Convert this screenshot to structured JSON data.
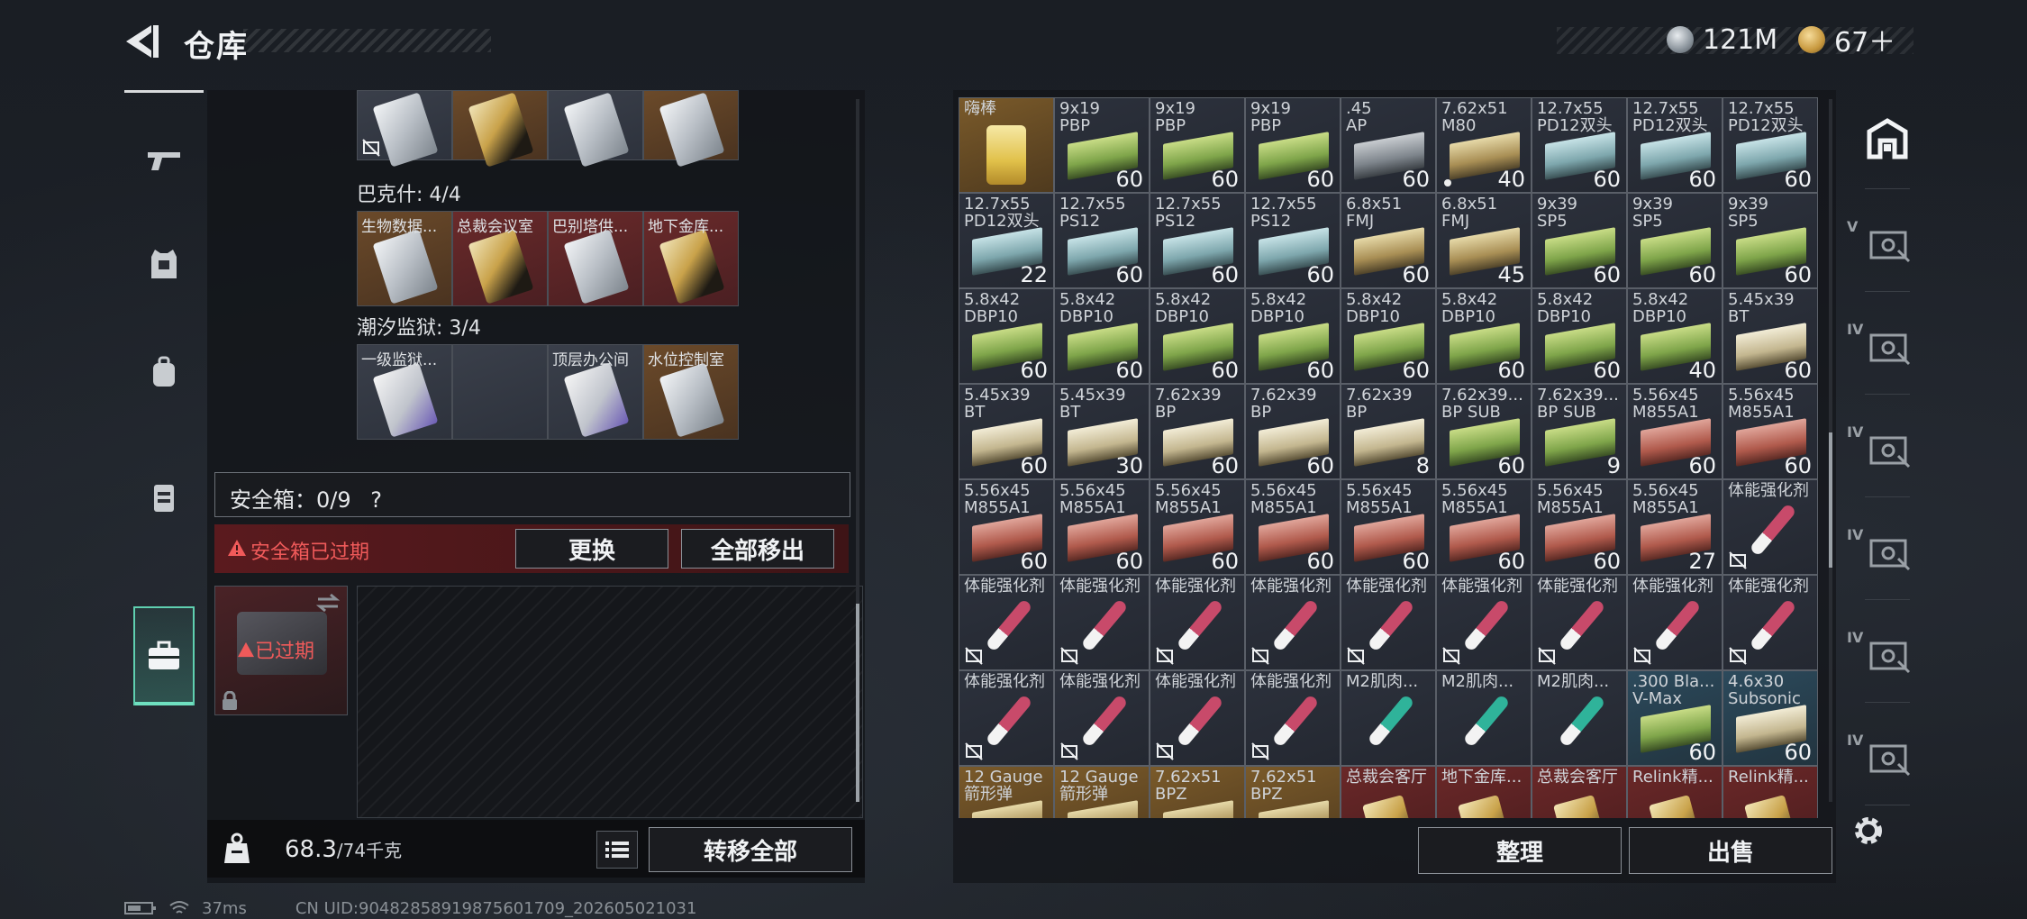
{
  "header": {
    "title": "仓库",
    "currency_silver": "121M",
    "currency_gold": "67＋"
  },
  "left_rail": [
    "weapons-tab",
    "armor-tab",
    "backpack-tab",
    "chest-rig-tab",
    "safebox-tab"
  ],
  "keycards": {
    "row0": [
      {
        "label": "",
        "style": "grey",
        "card": "silver",
        "locked": true
      },
      {
        "label": "",
        "style": "gold",
        "card": "goldc",
        "locked": false
      },
      {
        "label": "",
        "style": "grey",
        "card": "silver",
        "locked": false
      },
      {
        "label": "",
        "style": "gold",
        "card": "silver",
        "locked": false
      }
    ],
    "section1": "巴克什: 4/4",
    "row1": [
      {
        "label": "生物数据...",
        "style": "gold",
        "card": "silver",
        "locked": false
      },
      {
        "label": "总裁会议室",
        "style": "red",
        "card": "goldc",
        "locked": false
      },
      {
        "label": "巴别塔供...",
        "style": "red",
        "card": "silver",
        "locked": false
      },
      {
        "label": "地下金库...",
        "style": "red",
        "card": "goldc",
        "locked": false
      }
    ],
    "section2": "潮汐监狱: 3/4",
    "row2": [
      {
        "label": "一级监狱...",
        "style": "grey",
        "card": "purple",
        "locked": false
      },
      {
        "label": "",
        "style": "grey",
        "card": "",
        "locked": false
      },
      {
        "label": "顶层办公间",
        "style": "grey",
        "card": "purple",
        "locked": false
      },
      {
        "label": "水位控制室",
        "style": "gold",
        "card": "silver",
        "locked": false
      }
    ]
  },
  "safebox": {
    "label": "安全箱：0/9",
    "help": "?",
    "expired_banner": "安全箱已过期",
    "replace_button": "更换",
    "move_all_out_button": "全部移出",
    "case_status": "已过期"
  },
  "weight": {
    "current": "68.3",
    "max": "/74千克"
  },
  "transfer_all_button": "转移全部",
  "inventory": [
    [
      {
        "label": "嗨棒",
        "qty": "",
        "type": "drink",
        "bg": "gold"
      },
      {
        "label": "9x19\nPBP",
        "qty": "60",
        "type": "ammo",
        "color": "green"
      },
      {
        "label": "9x19\nPBP",
        "qty": "60",
        "type": "ammo",
        "color": "green"
      },
      {
        "label": "9x19\nPBP",
        "qty": "60",
        "type": "ammo",
        "color": "green"
      },
      {
        "label": ".45\nAP",
        "qty": "60",
        "type": "ammo",
        "color": "grey"
      },
      {
        "label": "7.62x51\nM80",
        "qty": "40",
        "type": "ammo",
        "color": "tan",
        "dot": true
      },
      {
        "label": "12.7x55\nPD12双头",
        "qty": "60",
        "type": "ammo",
        "color": "cyan"
      },
      {
        "label": "12.7x55\nPD12双头",
        "qty": "60",
        "type": "ammo",
        "color": "cyan"
      },
      {
        "label": "12.7x55\nPD12双头",
        "qty": "60",
        "type": "ammo",
        "color": "cyan"
      }
    ],
    [
      {
        "label": "12.7x55\nPD12双头",
        "qty": "22",
        "type": "ammo",
        "color": "cyan"
      },
      {
        "label": "12.7x55\nPS12",
        "qty": "60",
        "type": "ammo",
        "color": "cyan"
      },
      {
        "label": "12.7x55\nPS12",
        "qty": "60",
        "type": "ammo",
        "color": "cyan"
      },
      {
        "label": "12.7x55\nPS12",
        "qty": "60",
        "type": "ammo",
        "color": "cyan"
      },
      {
        "label": "6.8x51\nFMJ",
        "qty": "60",
        "type": "ammo",
        "color": "tan"
      },
      {
        "label": "6.8x51\nFMJ",
        "qty": "45",
        "type": "ammo",
        "color": "tan"
      },
      {
        "label": "9x39\nSP5",
        "qty": "60",
        "type": "ammo",
        "color": "green"
      },
      {
        "label": "9x39\nSP5",
        "qty": "60",
        "type": "ammo",
        "color": "green"
      },
      {
        "label": "9x39\nSP5",
        "qty": "60",
        "type": "ammo",
        "color": "green"
      }
    ],
    [
      {
        "label": "5.8x42\nDBP10",
        "qty": "60",
        "type": "ammo",
        "color": "green"
      },
      {
        "label": "5.8x42\nDBP10",
        "qty": "60",
        "type": "ammo",
        "color": "green"
      },
      {
        "label": "5.8x42\nDBP10",
        "qty": "60",
        "type": "ammo",
        "color": "green"
      },
      {
        "label": "5.8x42\nDBP10",
        "qty": "60",
        "type": "ammo",
        "color": "green"
      },
      {
        "label": "5.8x42\nDBP10",
        "qty": "60",
        "type": "ammo",
        "color": "green"
      },
      {
        "label": "5.8x42\nDBP10",
        "qty": "60",
        "type": "ammo",
        "color": "green"
      },
      {
        "label": "5.8x42\nDBP10",
        "qty": "60",
        "type": "ammo",
        "color": "green"
      },
      {
        "label": "5.8x42\nDBP10",
        "qty": "40",
        "type": "ammo",
        "color": "green"
      },
      {
        "label": "5.45x39\nBT",
        "qty": "60",
        "type": "ammo",
        "color": "cream"
      }
    ],
    [
      {
        "label": "5.45x39\nBT",
        "qty": "60",
        "type": "ammo",
        "color": "cream"
      },
      {
        "label": "5.45x39\nBT",
        "qty": "30",
        "type": "ammo",
        "color": "cream"
      },
      {
        "label": "7.62x39\nBP",
        "qty": "60",
        "type": "ammo",
        "color": "cream"
      },
      {
        "label": "7.62x39\nBP",
        "qty": "60",
        "type": "ammo",
        "color": "cream"
      },
      {
        "label": "7.62x39\nBP",
        "qty": "8",
        "type": "ammo",
        "color": "cream"
      },
      {
        "label": "7.62x39...\nBP SUB",
        "qty": "60",
        "type": "ammo",
        "color": "green"
      },
      {
        "label": "7.62x39...\nBP SUB",
        "qty": "9",
        "type": "ammo",
        "color": "green"
      },
      {
        "label": "5.56x45\nM855A1",
        "qty": "60",
        "type": "ammo",
        "color": "red"
      },
      {
        "label": "5.56x45\nM855A1",
        "qty": "60",
        "type": "ammo",
        "color": "red"
      }
    ],
    [
      {
        "label": "5.56x45\nM855A1",
        "qty": "60",
        "type": "ammo",
        "color": "red"
      },
      {
        "label": "5.56x45\nM855A1",
        "qty": "60",
        "type": "ammo",
        "color": "red"
      },
      {
        "label": "5.56x45\nM855A1",
        "qty": "60",
        "type": "ammo",
        "color": "red"
      },
      {
        "label": "5.56x45\nM855A1",
        "qty": "60",
        "type": "ammo",
        "color": "red"
      },
      {
        "label": "5.56x45\nM855A1",
        "qty": "60",
        "type": "ammo",
        "color": "red"
      },
      {
        "label": "5.56x45\nM855A1",
        "qty": "60",
        "type": "ammo",
        "color": "red"
      },
      {
        "label": "5.56x45\nM855A1",
        "qty": "60",
        "type": "ammo",
        "color": "red"
      },
      {
        "label": "5.56x45\nM855A1",
        "qty": "27",
        "type": "ammo",
        "color": "red"
      },
      {
        "label": "体能强化剂",
        "qty": "",
        "type": "syringe",
        "color": "pink",
        "locked": true
      }
    ],
    [
      {
        "label": "体能强化剂",
        "qty": "",
        "type": "syringe",
        "color": "pink",
        "locked": true
      },
      {
        "label": "体能强化剂",
        "qty": "",
        "type": "syringe",
        "color": "pink",
        "locked": true
      },
      {
        "label": "体能强化剂",
        "qty": "",
        "type": "syringe",
        "color": "pink",
        "locked": true
      },
      {
        "label": "体能强化剂",
        "qty": "",
        "type": "syringe",
        "color": "pink",
        "locked": true
      },
      {
        "label": "体能强化剂",
        "qty": "",
        "type": "syringe",
        "color": "pink",
        "locked": true
      },
      {
        "label": "体能强化剂",
        "qty": "",
        "type": "syringe",
        "color": "pink",
        "locked": true
      },
      {
        "label": "体能强化剂",
        "qty": "",
        "type": "syringe",
        "color": "pink",
        "locked": true
      },
      {
        "label": "体能强化剂",
        "qty": "",
        "type": "syringe",
        "color": "pink",
        "locked": true
      },
      {
        "label": "体能强化剂",
        "qty": "",
        "type": "syringe",
        "color": "pink",
        "locked": true
      }
    ],
    [
      {
        "label": "体能强化剂",
        "qty": "",
        "type": "syringe",
        "color": "pink",
        "locked": true
      },
      {
        "label": "体能强化剂",
        "qty": "",
        "type": "syringe",
        "color": "pink",
        "locked": true
      },
      {
        "label": "体能强化剂",
        "qty": "",
        "type": "syringe",
        "color": "pink",
        "locked": true
      },
      {
        "label": "体能强化剂",
        "qty": "",
        "type": "syringe",
        "color": "pink",
        "locked": true
      },
      {
        "label": "M2肌肉...",
        "qty": "",
        "type": "syringe",
        "color": "teal"
      },
      {
        "label": "M2肌肉...",
        "qty": "",
        "type": "syringe",
        "color": "teal"
      },
      {
        "label": "M2肌肉...",
        "qty": "",
        "type": "syringe",
        "color": "teal"
      },
      {
        "label": ".300 Bla...\nV-Max",
        "qty": "60",
        "type": "ammo",
        "color": "green",
        "bg": "blue"
      },
      {
        "label": "4.6x30\nSubsonic",
        "qty": "60",
        "type": "ammo",
        "color": "cream",
        "bg": "blue"
      }
    ],
    [
      {
        "label": "12 Gauge\n箭形弹",
        "qty": "",
        "type": "ammo",
        "color": "tan",
        "bg": "gold"
      },
      {
        "label": "12 Gauge\n箭形弹",
        "qty": "",
        "type": "ammo",
        "color": "tan",
        "bg": "gold"
      },
      {
        "label": "7.62x51\nBPZ",
        "qty": "",
        "type": "ammo",
        "color": "tan",
        "bg": "gold"
      },
      {
        "label": "7.62x51\nBPZ",
        "qty": "",
        "type": "ammo",
        "color": "tan",
        "bg": "gold"
      },
      {
        "label": "总裁会客厅",
        "qty": "",
        "type": "card",
        "bg": "red"
      },
      {
        "label": "地下金库...",
        "qty": "",
        "type": "card",
        "bg": "red"
      },
      {
        "label": "总裁会客厅",
        "qty": "",
        "type": "card",
        "bg": "red"
      },
      {
        "label": "Relink精...",
        "qty": "",
        "type": "card",
        "bg": "red"
      },
      {
        "label": "Relink精...",
        "qty": "",
        "type": "card",
        "bg": "red"
      }
    ]
  ],
  "sort_button": "整理",
  "sell_button": "出售",
  "right_rail": [
    {
      "icon": "warehouse-icon",
      "label": ""
    },
    {
      "icon": "storage-v-icon",
      "label": "V"
    },
    {
      "icon": "storage-iv-icon",
      "label": "IV"
    },
    {
      "icon": "storage-iv-icon",
      "label": "IV"
    },
    {
      "icon": "storage-iv-icon",
      "label": "IV"
    },
    {
      "icon": "storage-iv-icon",
      "label": "IV"
    },
    {
      "icon": "storage-iv-icon",
      "label": "IV"
    }
  ],
  "status": {
    "ping": "37ms",
    "uid": "CN UID:90482858919875601709_202605021031"
  }
}
